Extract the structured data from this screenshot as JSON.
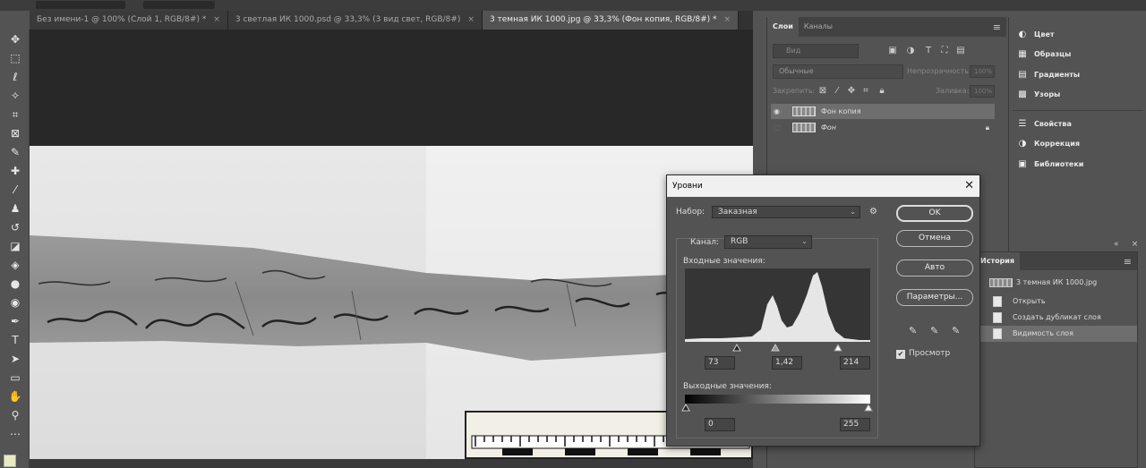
{
  "tabs": [
    {
      "label": "Без имени-1 @ 100% (Слой 1, RGB/8#) *",
      "close": "×"
    },
    {
      "label": "3 светлая ИК 1000.psd @ 33,3% (3 вид свет, RGB/8#)",
      "close": "×"
    },
    {
      "label": "3 темная ИК 1000.jpg @ 33,3% (Фон копия, RGB/8#) *",
      "close": "×"
    }
  ],
  "tools": [
    {
      "name": "move-tool-icon",
      "glyph": "✥"
    },
    {
      "name": "marquee-tool-icon",
      "glyph": "⬚"
    },
    {
      "name": "lasso-tool-icon",
      "glyph": "ℓ"
    },
    {
      "name": "magic-wand-tool-icon",
      "glyph": "✧"
    },
    {
      "name": "crop-tool-icon",
      "glyph": "⌗"
    },
    {
      "name": "frame-tool-icon",
      "glyph": "⊠"
    },
    {
      "name": "eyedropper-tool-icon",
      "glyph": "✎"
    },
    {
      "name": "healing-brush-tool-icon",
      "glyph": "✚"
    },
    {
      "name": "brush-tool-icon",
      "glyph": "⁄"
    },
    {
      "name": "clone-stamp-tool-icon",
      "glyph": "♟"
    },
    {
      "name": "history-brush-tool-icon",
      "glyph": "↺"
    },
    {
      "name": "eraser-tool-icon",
      "glyph": "◪"
    },
    {
      "name": "paint-bucket-tool-icon",
      "glyph": "◈"
    },
    {
      "name": "blur-tool-icon",
      "glyph": "●"
    },
    {
      "name": "dodge-tool-icon",
      "glyph": "◉"
    },
    {
      "name": "pen-tool-icon",
      "glyph": "✒"
    },
    {
      "name": "type-tool-icon",
      "glyph": "T"
    },
    {
      "name": "path-selection-tool-icon",
      "glyph": "➤"
    },
    {
      "name": "rectangle-tool-icon",
      "glyph": "▭"
    },
    {
      "name": "hand-tool-icon",
      "glyph": "✋"
    },
    {
      "name": "zoom-tool-icon",
      "glyph": "⚲"
    },
    {
      "name": "more-tools-icon",
      "glyph": "⋯"
    }
  ],
  "layers_panel": {
    "tabs": [
      "Слои",
      "Каналы"
    ],
    "filter_placeholder": "Вид",
    "blend_mode": "Обычные",
    "opacity_label": "Непрозрачность:",
    "opacity_value": "100%",
    "lock_label": "Закрепить:",
    "fill_label": "Заливка:",
    "fill_value": "100%",
    "layers": [
      {
        "name": "Фон копия",
        "visible": true,
        "selected": true,
        "locked": false
      },
      {
        "name": "Фон",
        "visible": false,
        "selected": false,
        "locked": true
      }
    ]
  },
  "side_panel": {
    "items": [
      {
        "label": "Цвет",
        "icon": "color-icon"
      },
      {
        "label": "Образцы",
        "icon": "swatches-icon"
      },
      {
        "label": "Градиенты",
        "icon": "gradients-icon"
      },
      {
        "label": "Узоры",
        "icon": "patterns-icon"
      },
      {
        "label": "Свойства",
        "icon": "properties-icon"
      },
      {
        "label": "Коррекция",
        "icon": "adjustments-icon"
      },
      {
        "label": "Библиотеки",
        "icon": "libraries-icon"
      }
    ]
  },
  "history": {
    "tab": "История",
    "snapshot": "3 темная ИК 1000.jpg",
    "steps": [
      "Открыть",
      "Создать дубликат слоя",
      "Видимость слоя"
    ]
  },
  "levels": {
    "title": "Уровни",
    "preset_label": "Набор:",
    "preset_value": "Заказная",
    "channel_label": "Канал:",
    "channel_value": "RGB",
    "input_label": "Входные значения:",
    "input_black": "73",
    "input_gamma": "1,42",
    "input_white": "214",
    "output_label": "Выходные значения:",
    "output_black": "0",
    "output_white": "255",
    "buttons": {
      "ok": "OK",
      "cancel": "Отмена",
      "auto": "Авто",
      "options": "Параметры..."
    },
    "preview_label": "Просмотр",
    "preview_checked": true
  }
}
